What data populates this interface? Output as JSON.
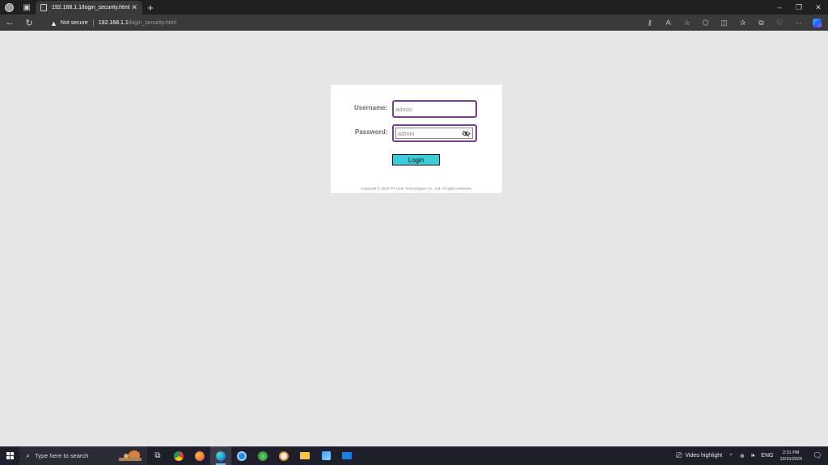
{
  "browser": {
    "tab_title": "192.168.1.1/login_security.html",
    "not_secure": "Not secure",
    "url_host": "192.168.1.1",
    "url_path": "/login_security.html"
  },
  "login": {
    "username_label": "Username:",
    "username_value": "admin",
    "password_label": "Password:",
    "password_value": "admin",
    "login_button": "Login",
    "copyright": "Copyright © 2016 TP-LINK Technologies Co., Ltd. All rights reserved.",
    "field_border_color": "#7b3f8f",
    "button_color": "#3ecad6"
  },
  "taskbar": {
    "search_placeholder": "Type here to search",
    "video_highlight": "Video highlight",
    "language": "ENG",
    "time": "2:31 PM",
    "date": "10/15/2024"
  }
}
